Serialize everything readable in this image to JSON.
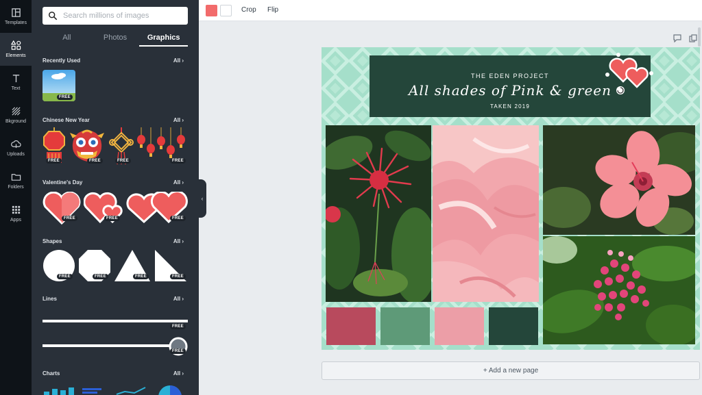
{
  "rail": [
    {
      "label": "Templates",
      "icon": "templates-icon"
    },
    {
      "label": "Elements",
      "icon": "elements-icon"
    },
    {
      "label": "Text",
      "icon": "text-icon"
    },
    {
      "label": "Bkground",
      "icon": "background-icon"
    },
    {
      "label": "Uploads",
      "icon": "upload-icon"
    },
    {
      "label": "Folders",
      "icon": "folder-icon"
    },
    {
      "label": "Apps",
      "icon": "apps-icon"
    }
  ],
  "search": {
    "placeholder": "Search millions of images"
  },
  "tabs": [
    "All",
    "Photos",
    "Graphics"
  ],
  "sections": {
    "recent": {
      "title": "Recently Used",
      "all": "All"
    },
    "cny": {
      "title": "Chinese New Year",
      "all": "All"
    },
    "valentine": {
      "title": "Valentine's Day",
      "all": "All"
    },
    "shapes": {
      "title": "Shapes",
      "all": "All"
    },
    "lines": {
      "title": "Lines",
      "all": "All"
    },
    "charts": {
      "title": "Charts",
      "all": "All"
    }
  },
  "free_badge": "FREE",
  "toolbar": {
    "color1": "#f26b6b",
    "color2": "#ffffff",
    "crop": "Crop",
    "flip": "Flip"
  },
  "banner": {
    "line1": "THE EDEN PROJECT",
    "line2": "All shades of Pink & green",
    "line3": "TAKEN 2019"
  },
  "palette": [
    "#b84a5d",
    "#5e9a78",
    "#ec9ea7",
    "#24463a"
  ],
  "add_page": "+ Add a new page"
}
